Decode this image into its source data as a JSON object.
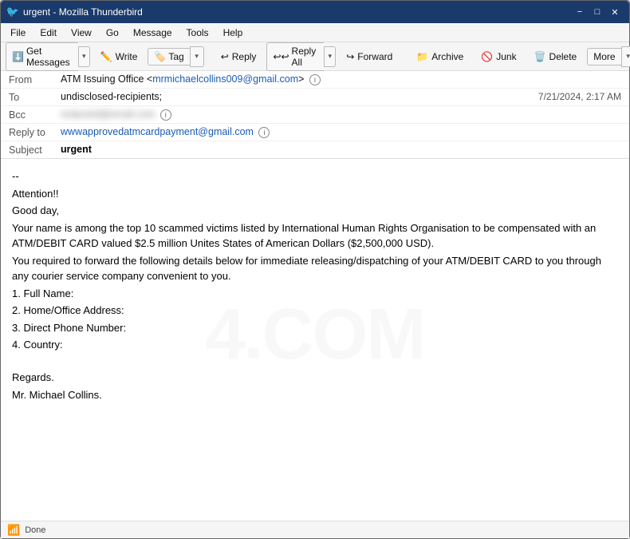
{
  "window": {
    "title": "urgent - Mozilla Thunderbird",
    "title_icon": "🐦",
    "controls": {
      "minimize": "−",
      "maximize": "□",
      "close": "✕"
    }
  },
  "menu": {
    "items": [
      "File",
      "Edit",
      "View",
      "Go",
      "Message",
      "Tools",
      "Help"
    ]
  },
  "toolbar": {
    "get_messages_label": "Get Messages",
    "write_label": "Write",
    "tag_label": "Tag",
    "reply_label": "Reply",
    "reply_all_label": "Reply All",
    "forward_label": "Forward",
    "archive_label": "Archive",
    "junk_label": "Junk",
    "delete_label": "Delete",
    "more_label": "More"
  },
  "email": {
    "from_label": "From",
    "from_name": "ATM Issuing Office",
    "from_email": "mrmichaelcollins009@gmail.com",
    "to_label": "To",
    "to_value": "undisclosed-recipients;",
    "date": "7/21/2024, 2:17 AM",
    "bcc_label": "Bcc",
    "bcc_value": "redacted@email.com",
    "reply_to_label": "Reply to",
    "reply_to_value": "wwwapprovedatmcardpayment@gmail.com",
    "subject_label": "Subject",
    "subject_value": "urgent",
    "body_separator": "--",
    "body_lines": [
      "Attention!!",
      "Good day,",
      "Your name is among the top 10 scammed victims listed by International Human Rights Organisation to be compensated with an ATM/DEBIT CARD valued $2.5 million Unites States of American Dollars ($2,500,000 USD).",
      "You  required to forward the following details below for immediate releasing/dispatching of your ATM/DEBIT CARD to you through any courier service company convenient to you.",
      "1. Full Name:",
      "2. Home/Office Address:",
      "3. Direct Phone Number:",
      "4. Country:",
      "",
      "Regards.",
      "Mr. Michael Collins."
    ],
    "watermark": "4.COM"
  },
  "status_bar": {
    "signal_icon": "📶",
    "status_text": "Done"
  }
}
